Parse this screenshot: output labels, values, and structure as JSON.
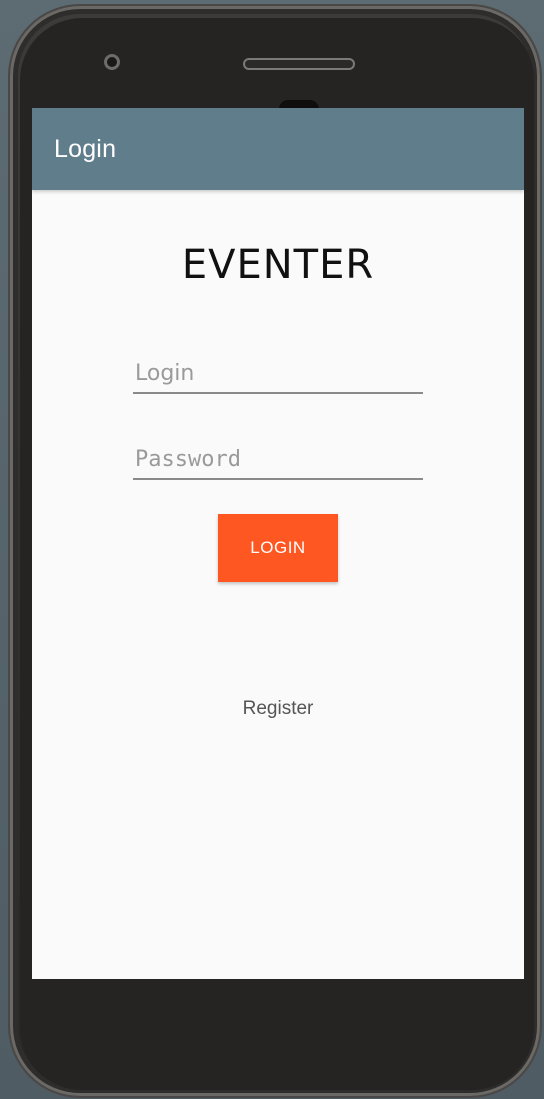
{
  "app_bar": {
    "title": "Login",
    "color": "#607d8b"
  },
  "main": {
    "app_name": "EVENTER",
    "login_field": {
      "value": "",
      "placeholder": "Login"
    },
    "password_field": {
      "value": "",
      "placeholder": "Password"
    },
    "login_button": {
      "label": "LOGIN",
      "color": "#ff5722"
    },
    "register_link": {
      "label": "Register"
    }
  }
}
